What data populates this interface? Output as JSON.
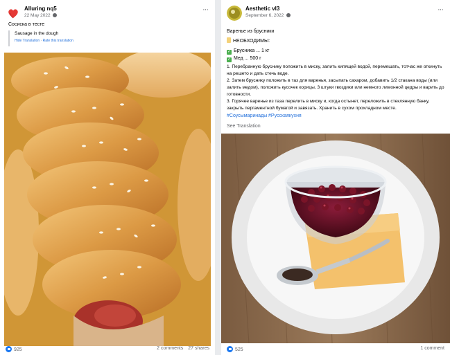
{
  "colors": {
    "accent": "#1877f2",
    "link": "#216fdb",
    "muted": "#65676b"
  },
  "left_post": {
    "author": "Alluring nq5",
    "date": "22 May 2022",
    "privacy_icon": "globe-icon",
    "more_label": "···",
    "text": "Сосиска в тесте",
    "translation": {
      "original": "Sausage in the dough",
      "hide": "Hide Translation",
      "separator": " · ",
      "rate": "Rate this translation"
    },
    "image_alt": "Sausage rolls with sesame seeds",
    "reactions": "925",
    "comments": "2 comments",
    "shares": "27 shares"
  },
  "right_post": {
    "author": "Aesthetic vl3",
    "date": "September 6, 2022",
    "privacy_icon": "globe-icon",
    "more_label": "···",
    "title": "Варенье из брусники",
    "needed_label": "НЕОБХОДИМЫ:",
    "ingredients": [
      "Брусника ... 1 кг",
      "Мед ... 500 г"
    ],
    "steps": [
      "1. Перебранную бруснику положить в миску, залить кипящей водой, перемешать, тотчас же откинуть на решето и дать стечь воде.",
      "2. Затем бруснику положить в таз для варенья, засыпать сахаром, добавить 1/2 стакана воды (или залить медом), положить кусочек корицы, 3 штуки гвоздики или немного лимонной цедры и варить до готовности.",
      "3. Горячее варенье из таза перелить в миску и, когда остынет, переложить в стеклянную банку, закрыть пергаментной бумагой и завязать. Хранить в сухом прохладном месте."
    ],
    "hashtags": "#Соусымаринады #Русскаякухня",
    "see_translation": "See Translation",
    "image_alt": "Lingonberry jam in a glass bowl with spoon",
    "reactions": "525",
    "comments": "1 comment"
  }
}
